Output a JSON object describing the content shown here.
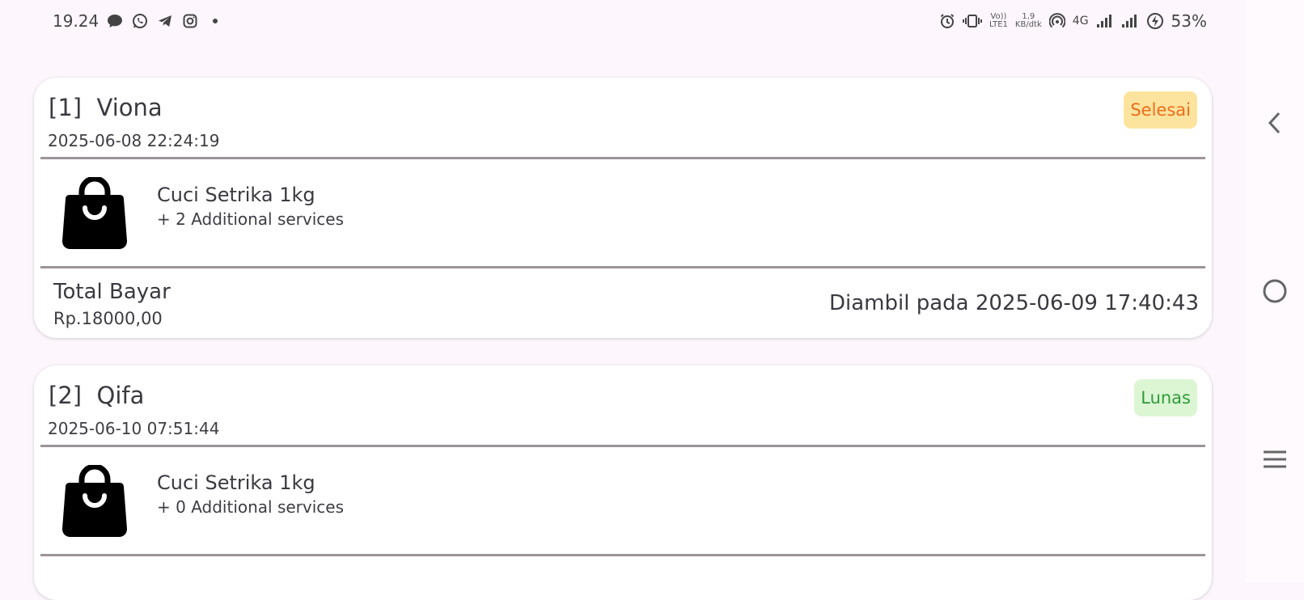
{
  "status_bar": {
    "time": "19.24",
    "left_icons": [
      "message-icon",
      "whatsapp-icon",
      "telegram-icon",
      "instagram-icon",
      "dot-icon"
    ],
    "volte_top": "Vo))",
    "volte_bottom": "LTE1",
    "speed_top": "1,9",
    "speed_bottom": "KB/dtk",
    "network": "4G",
    "battery": "53%"
  },
  "orders": [
    {
      "title": "[1]  Viona",
      "date": "2025-06-08 22:24:19",
      "status": "Selesai",
      "status_color": "#ec6d1d",
      "service": "Cuci Setrika 1kg",
      "additional": "+ 2 Additional services",
      "total_label": "Total Bayar",
      "total_value": "Rp.18000,00",
      "pickup": "Diambil pada 2025-06-09 17:40:43"
    },
    {
      "title": "[2]  Qifa",
      "date": "2025-06-10 07:51:44",
      "status": "Lunas",
      "status_color": "#2e9c3b",
      "service": "Cuci Setrika 1kg",
      "additional": "+ 0 Additional services"
    }
  ],
  "nav": {
    "icons": [
      "back-icon",
      "home-icon",
      "recents-icon"
    ]
  }
}
